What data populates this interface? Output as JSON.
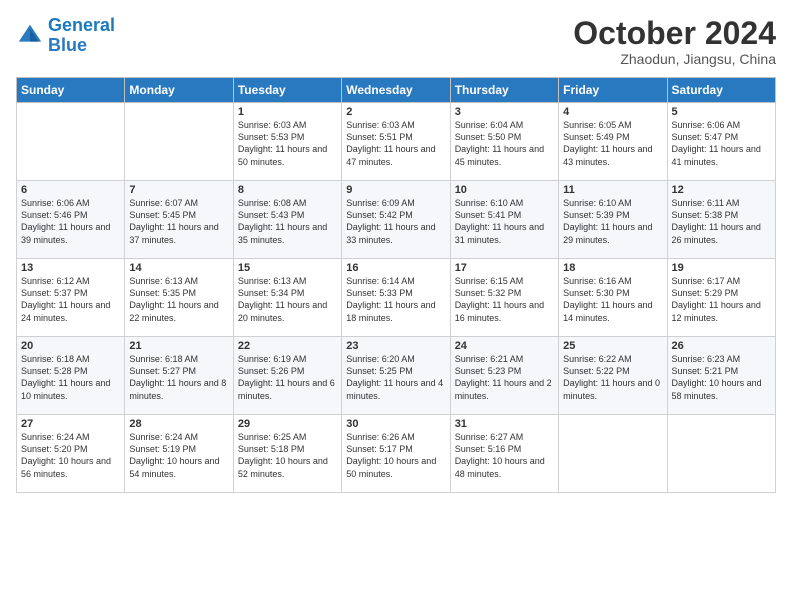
{
  "logo": {
    "line1": "General",
    "line2": "Blue"
  },
  "title": "October 2024",
  "location": "Zhaodun, Jiangsu, China",
  "days_header": [
    "Sunday",
    "Monday",
    "Tuesday",
    "Wednesday",
    "Thursday",
    "Friday",
    "Saturday"
  ],
  "weeks": [
    [
      {
        "day": "",
        "info": ""
      },
      {
        "day": "",
        "info": ""
      },
      {
        "day": "1",
        "info": "Sunrise: 6:03 AM\nSunset: 5:53 PM\nDaylight: 11 hours and 50 minutes."
      },
      {
        "day": "2",
        "info": "Sunrise: 6:03 AM\nSunset: 5:51 PM\nDaylight: 11 hours and 47 minutes."
      },
      {
        "day": "3",
        "info": "Sunrise: 6:04 AM\nSunset: 5:50 PM\nDaylight: 11 hours and 45 minutes."
      },
      {
        "day": "4",
        "info": "Sunrise: 6:05 AM\nSunset: 5:49 PM\nDaylight: 11 hours and 43 minutes."
      },
      {
        "day": "5",
        "info": "Sunrise: 6:06 AM\nSunset: 5:47 PM\nDaylight: 11 hours and 41 minutes."
      }
    ],
    [
      {
        "day": "6",
        "info": "Sunrise: 6:06 AM\nSunset: 5:46 PM\nDaylight: 11 hours and 39 minutes."
      },
      {
        "day": "7",
        "info": "Sunrise: 6:07 AM\nSunset: 5:45 PM\nDaylight: 11 hours and 37 minutes."
      },
      {
        "day": "8",
        "info": "Sunrise: 6:08 AM\nSunset: 5:43 PM\nDaylight: 11 hours and 35 minutes."
      },
      {
        "day": "9",
        "info": "Sunrise: 6:09 AM\nSunset: 5:42 PM\nDaylight: 11 hours and 33 minutes."
      },
      {
        "day": "10",
        "info": "Sunrise: 6:10 AM\nSunset: 5:41 PM\nDaylight: 11 hours and 31 minutes."
      },
      {
        "day": "11",
        "info": "Sunrise: 6:10 AM\nSunset: 5:39 PM\nDaylight: 11 hours and 29 minutes."
      },
      {
        "day": "12",
        "info": "Sunrise: 6:11 AM\nSunset: 5:38 PM\nDaylight: 11 hours and 26 minutes."
      }
    ],
    [
      {
        "day": "13",
        "info": "Sunrise: 6:12 AM\nSunset: 5:37 PM\nDaylight: 11 hours and 24 minutes."
      },
      {
        "day": "14",
        "info": "Sunrise: 6:13 AM\nSunset: 5:35 PM\nDaylight: 11 hours and 22 minutes."
      },
      {
        "day": "15",
        "info": "Sunrise: 6:13 AM\nSunset: 5:34 PM\nDaylight: 11 hours and 20 minutes."
      },
      {
        "day": "16",
        "info": "Sunrise: 6:14 AM\nSunset: 5:33 PM\nDaylight: 11 hours and 18 minutes."
      },
      {
        "day": "17",
        "info": "Sunrise: 6:15 AM\nSunset: 5:32 PM\nDaylight: 11 hours and 16 minutes."
      },
      {
        "day": "18",
        "info": "Sunrise: 6:16 AM\nSunset: 5:30 PM\nDaylight: 11 hours and 14 minutes."
      },
      {
        "day": "19",
        "info": "Sunrise: 6:17 AM\nSunset: 5:29 PM\nDaylight: 11 hours and 12 minutes."
      }
    ],
    [
      {
        "day": "20",
        "info": "Sunrise: 6:18 AM\nSunset: 5:28 PM\nDaylight: 11 hours and 10 minutes."
      },
      {
        "day": "21",
        "info": "Sunrise: 6:18 AM\nSunset: 5:27 PM\nDaylight: 11 hours and 8 minutes."
      },
      {
        "day": "22",
        "info": "Sunrise: 6:19 AM\nSunset: 5:26 PM\nDaylight: 11 hours and 6 minutes."
      },
      {
        "day": "23",
        "info": "Sunrise: 6:20 AM\nSunset: 5:25 PM\nDaylight: 11 hours and 4 minutes."
      },
      {
        "day": "24",
        "info": "Sunrise: 6:21 AM\nSunset: 5:23 PM\nDaylight: 11 hours and 2 minutes."
      },
      {
        "day": "25",
        "info": "Sunrise: 6:22 AM\nSunset: 5:22 PM\nDaylight: 11 hours and 0 minutes."
      },
      {
        "day": "26",
        "info": "Sunrise: 6:23 AM\nSunset: 5:21 PM\nDaylight: 10 hours and 58 minutes."
      }
    ],
    [
      {
        "day": "27",
        "info": "Sunrise: 6:24 AM\nSunset: 5:20 PM\nDaylight: 10 hours and 56 minutes."
      },
      {
        "day": "28",
        "info": "Sunrise: 6:24 AM\nSunset: 5:19 PM\nDaylight: 10 hours and 54 minutes."
      },
      {
        "day": "29",
        "info": "Sunrise: 6:25 AM\nSunset: 5:18 PM\nDaylight: 10 hours and 52 minutes."
      },
      {
        "day": "30",
        "info": "Sunrise: 6:26 AM\nSunset: 5:17 PM\nDaylight: 10 hours and 50 minutes."
      },
      {
        "day": "31",
        "info": "Sunrise: 6:27 AM\nSunset: 5:16 PM\nDaylight: 10 hours and 48 minutes."
      },
      {
        "day": "",
        "info": ""
      },
      {
        "day": "",
        "info": ""
      }
    ]
  ]
}
